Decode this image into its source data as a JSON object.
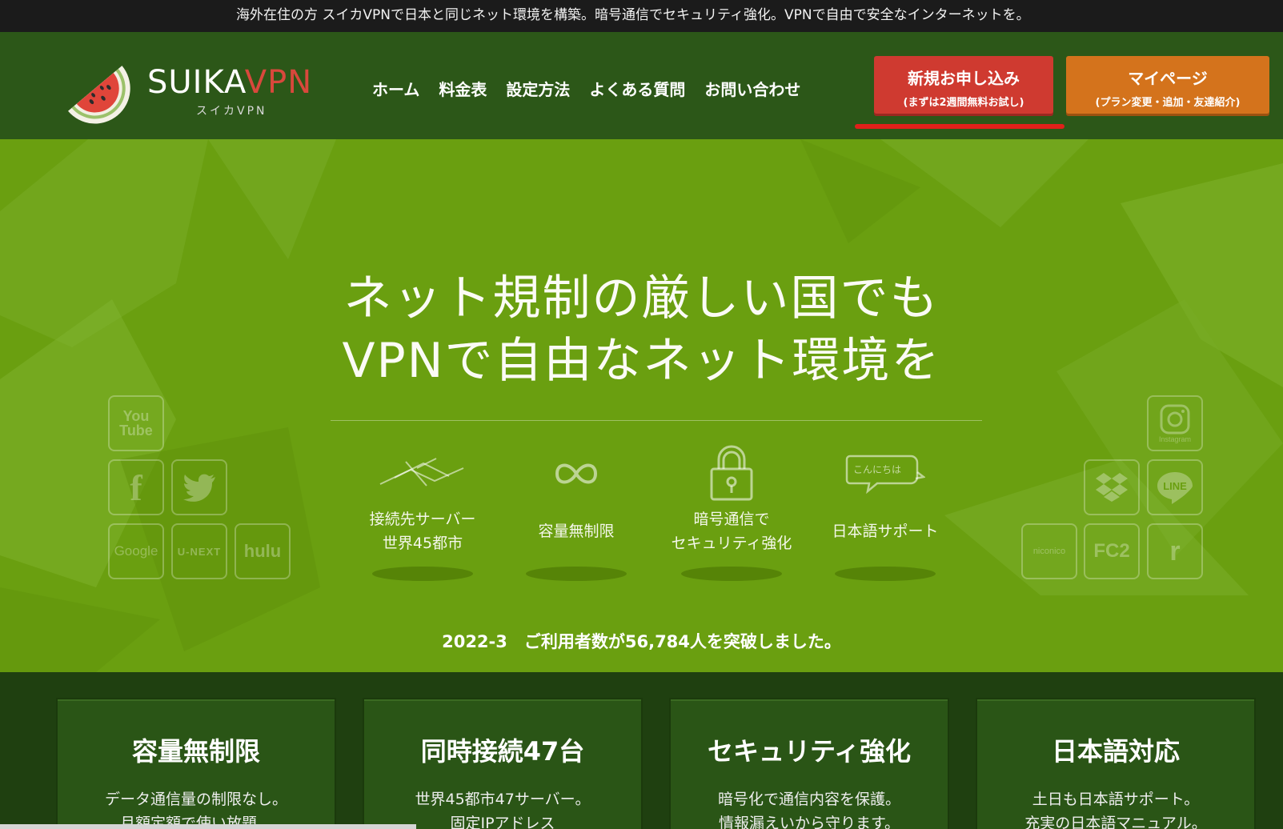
{
  "top_notice": "海外在住の方 スイカVPNで日本と同じネット環境を構築。暗号通信でセキュリティ強化。VPNで自由で安全なインターネットを。",
  "brand": {
    "name_part1": "SUIKA",
    "name_part2": "VPN",
    "sub": "スイカVPN"
  },
  "nav": [
    "ホーム",
    "料金表",
    "設定方法",
    "よくある質問",
    "お問い合わせ"
  ],
  "cta": {
    "signup_main": "新規お申し込み",
    "signup_sub": "(まずは2週間無料お試し)",
    "mypage_main": "マイページ",
    "mypage_sub": "(プラン変更・追加・友達紹介)"
  },
  "hero": {
    "line1": "ネット規制の厳しい国でも",
    "line2": "VPNで自由なネット環境を",
    "features": [
      {
        "icon": "network-icon",
        "line1": "接続先サーバー",
        "line2": "世界45都市"
      },
      {
        "icon": "infinity-icon",
        "line1": "容量無制限",
        "line2": ""
      },
      {
        "icon": "lock-icon",
        "line1": "暗号通信で",
        "line2": "セキュリティ強化"
      },
      {
        "icon": "speech-bubble-icon",
        "bubble": "こんにちは",
        "line1": "日本語サポート",
        "line2": ""
      }
    ],
    "users_notice": "2022-3　ご利用者数が56,784人を突破しました。"
  },
  "services_left": [
    "You Tube",
    "Facebook",
    "Twitter",
    "Google",
    "U-NEXT",
    "hulu"
  ],
  "services_left_labels": {
    "youtube_1": "You",
    "youtube_2": "Tube",
    "facebook": "f",
    "google": "Google",
    "unext": "U-NEXT",
    "hulu": "hulu"
  },
  "services_right": [
    "Instagram",
    "Dropbox",
    "LINE",
    "niconico",
    "FC2",
    "radiko"
  ],
  "services_right_labels": {
    "instagram": "Instagram",
    "line": "LINE",
    "niconico": "niconico",
    "fc2": "FC2",
    "radiko": "r"
  },
  "cards": [
    {
      "title": "容量無制限",
      "line1": "データ通信量の制限なし。",
      "line2": "月額定額で使い放題。"
    },
    {
      "title": "同時接続47台",
      "line1": "世界45都市47サーバー。",
      "line2": "固定IPアドレス"
    },
    {
      "title": "セキュリティ強化",
      "line1": "暗号化で通信内容を保護。",
      "line2": "情報漏えいから守ります。"
    },
    {
      "title": "日本語対応",
      "line1": "土日も日本語サポート。",
      "line2": "充実の日本語マニュアル。"
    }
  ],
  "colors": {
    "header_bg": "#2c5718",
    "hero_bg": "#6a9f10",
    "signup_red": "#cf3a30",
    "mypage_orange": "#d4731c"
  }
}
